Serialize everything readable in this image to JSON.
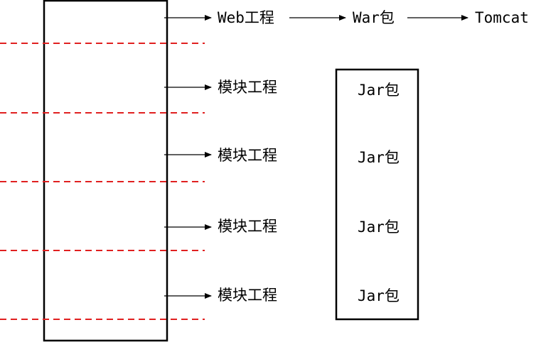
{
  "top_chain": {
    "web_project": "Web工程",
    "war_package": "War包",
    "tomcat": "Tomcat"
  },
  "modules": [
    {
      "label": "模块工程"
    },
    {
      "label": "模块工程"
    },
    {
      "label": "模块工程"
    },
    {
      "label": "模块工程"
    }
  ],
  "jar_box": {
    "items": [
      {
        "label": "Jar包"
      },
      {
        "label": "Jar包"
      },
      {
        "label": "Jar包"
      },
      {
        "label": "Jar包"
      }
    ]
  },
  "colors": {
    "stroke": "#000000",
    "divider": "#e02020"
  }
}
